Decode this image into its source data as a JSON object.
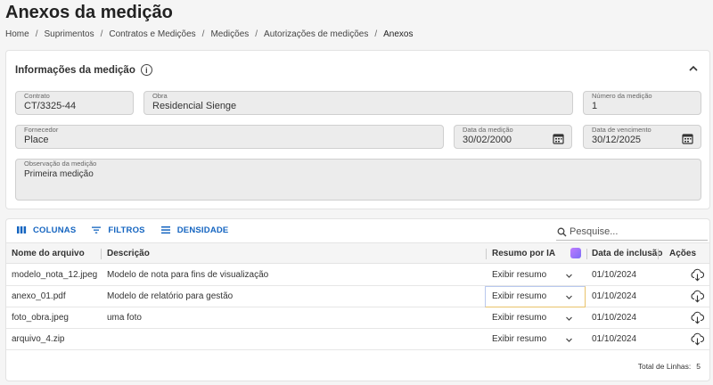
{
  "page": {
    "title": "Anexos da medição"
  },
  "breadcrumb": [
    "Home",
    "Suprimentos",
    "Contratos e Medições",
    "Medições",
    "Autorizações de medições",
    "Anexos"
  ],
  "info_card": {
    "title": "Informações da medição",
    "fields": {
      "contrato": {
        "label": "Contrato",
        "value": "CT/3325-44"
      },
      "obra": {
        "label": "Obra",
        "value": "Residencial Sienge"
      },
      "numero": {
        "label": "Número da medição",
        "value": "1"
      },
      "fornecedor": {
        "label": "Fornecedor",
        "value": "Place"
      },
      "data_medicao": {
        "label": "Data da medição",
        "value": "30/02/2000"
      },
      "data_vencimento": {
        "label": "Data de vencimento",
        "value": "30/12/2025"
      },
      "observacao": {
        "label": "Observação da medição",
        "value": "Primeira medição"
      }
    }
  },
  "toolbar": {
    "columns_label": "COLUNAS",
    "filters_label": "FILTROS",
    "density_label": "DENSIDADE",
    "search_placeholder": "Pesquise..."
  },
  "table": {
    "headers": {
      "file": "Nome do arquivo",
      "description": "Descrição",
      "summary": "Resumo por IA",
      "date": "Data de inclusão",
      "actions": "Ações"
    },
    "rows": [
      {
        "file": "modelo_nota_12.jpeg",
        "description": "Modelo de nota para fins de visualização",
        "summary": "Exibir resumo",
        "date": "01/10/2024"
      },
      {
        "file": "anexo_01.pdf",
        "description": "Modelo de relatório para gestão",
        "summary": "Exibir resumo",
        "date": "01/10/2024"
      },
      {
        "file": "foto_obra.jpeg",
        "description": "uma foto",
        "summary": "Exibir resumo",
        "date": "01/10/2024"
      },
      {
        "file": "arquivo_4.zip",
        "description": "",
        "summary": "Exibir resumo",
        "date": "01/10/2024"
      }
    ],
    "footer_label": "Total de Linhas:",
    "total_rows": "5"
  },
  "colors": {
    "accent": "#1565c0",
    "field_bg": "#ececec"
  }
}
